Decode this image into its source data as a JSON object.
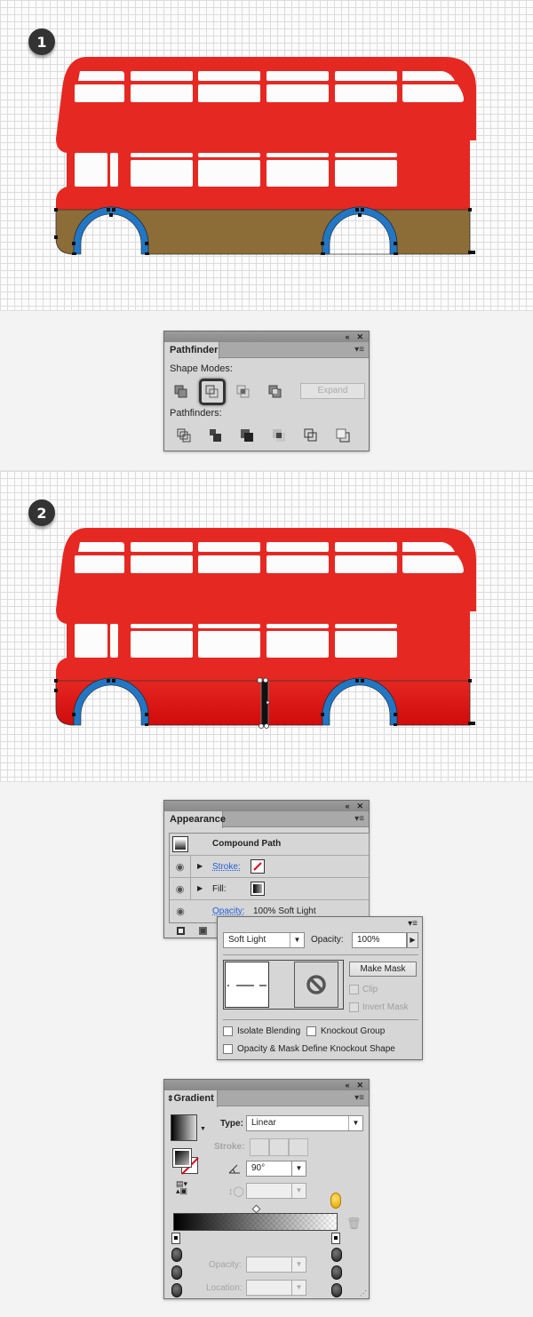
{
  "steps": [
    {
      "number": "1"
    },
    {
      "number": "2"
    }
  ],
  "colors": {
    "bus_red": "#e62822",
    "bus_base_brown": "#8c6d37",
    "wheel_arch_blue": "#2277c4",
    "gradient_red_dark": "#d00b0b"
  },
  "pathfinder": {
    "tab": "Pathfinder",
    "collapse_icon": "double-left-arrow",
    "close_icon": "x",
    "menu_icon": "panel-menu",
    "shape_modes_label": "Shape Modes:",
    "shape_modes": [
      "unite",
      "minus-front",
      "intersect",
      "exclude"
    ],
    "selected_shape_mode": "minus-front",
    "expand_label": "Expand",
    "pathfinders_label": "Pathfinders:",
    "pathfinders": [
      "divide",
      "trim",
      "merge",
      "crop",
      "outline",
      "minus-back"
    ]
  },
  "appearance": {
    "tab": "Appearance",
    "object_label": "Compound Path",
    "rows": [
      {
        "label": "Stroke:",
        "link": true,
        "swatch": "none-red-slash"
      },
      {
        "label": "Fill:",
        "link": false,
        "swatch": "black-gradient"
      },
      {
        "label": "Opacity:",
        "value": "100% Soft Light",
        "link": true
      }
    ],
    "footer_icons": [
      "add-new-stroke",
      "add-new-fill"
    ]
  },
  "transparency": {
    "blend_mode": "Soft Light",
    "opacity_label": "Opacity:",
    "opacity_value": "100%",
    "make_mask_label": "Make Mask",
    "clip_label": "Clip",
    "invert_mask_label": "Invert Mask",
    "isolate_blending_label": "Isolate Blending",
    "knockout_group_label": "Knockout Group",
    "opacity_mask_knockout_label": "Opacity & Mask Define Knockout Shape",
    "isolate_blending": false,
    "knockout_group": false,
    "opacity_mask_knockout": false,
    "clip": false,
    "invert_mask": false
  },
  "gradient": {
    "tab": "Gradient",
    "type_label": "Type:",
    "type_value": "Linear",
    "stroke_label": "Stroke:",
    "angle_value": "90°",
    "aspect_value": "",
    "opacity_label": "Opacity:",
    "opacity_value": "",
    "location_label": "Location:",
    "location_value": "",
    "stops": [
      {
        "color": "#000000",
        "location": 0
      },
      {
        "color": "transparent",
        "location": 100
      }
    ],
    "midpoint": 50
  }
}
